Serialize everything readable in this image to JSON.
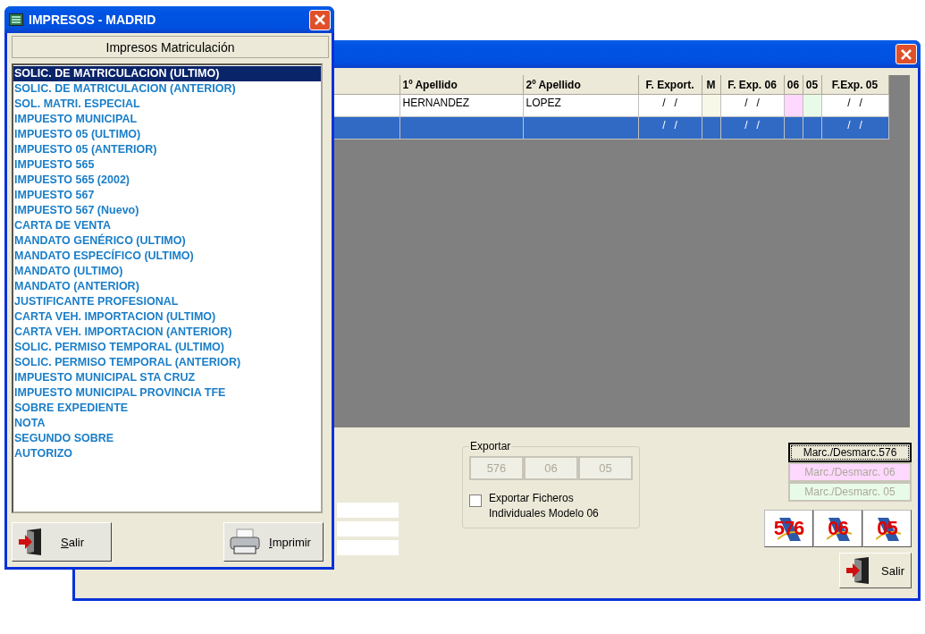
{
  "back_window": {
    "table": {
      "columns": [
        {
          "label": "1º Apellido",
          "kind": "name"
        },
        {
          "label": "2º Apellido",
          "kind": "name"
        },
        {
          "label": "F. Export.",
          "kind": "date"
        },
        {
          "label": "M",
          "kind": "flag",
          "color": "#f8f8e8"
        },
        {
          "label": "F. Exp. 06",
          "kind": "date"
        },
        {
          "label": "06",
          "kind": "flag",
          "color": "#ffd8ff"
        },
        {
          "label": "05",
          "kind": "flag",
          "color": "#e8fbe8"
        },
        {
          "label": "F.Exp. 05",
          "kind": "date"
        }
      ],
      "rows": [
        {
          "selected": false,
          "names": [
            "HERNANDEZ",
            "LOPEZ"
          ],
          "dates": [
            "/   /",
            "/   /",
            "/   /"
          ]
        },
        {
          "selected": true,
          "dates": [
            "/   /",
            "/   /",
            "/   /"
          ]
        }
      ]
    },
    "exportar": {
      "title": "Exportar",
      "buttons": [
        {
          "label": "576",
          "disabled": true
        },
        {
          "label": "06",
          "disabled": true
        },
        {
          "label": "05",
          "disabled": true
        }
      ],
      "checkbox": {
        "label": "Exportar Ficheros Individuales Modelo 06",
        "checked": false
      }
    },
    "mark_buttons": [
      {
        "label": "Marc./Desmarc.576",
        "disabled": false,
        "color": "#ece9d8",
        "focused": true
      },
      {
        "label": "Marc./Desmarc. 06",
        "disabled": true,
        "color": "#ffd8ff",
        "focused": false
      },
      {
        "label": "Marc./Desmarc. 05",
        "disabled": true,
        "color": "#e8fbe8",
        "focused": false
      }
    ],
    "form_buttons": [
      {
        "label": "576"
      },
      {
        "label": "06"
      },
      {
        "label": "05"
      }
    ],
    "exit_button": {
      "label": "Salir"
    }
  },
  "front_window": {
    "title": "IMPRESOS - MADRID",
    "header": "Impresos Matriculación",
    "items": [
      {
        "label": "SOLIC. DE MATRICULACION (ULTIMO)",
        "selected": true
      },
      {
        "label": "SOLIC. DE MATRICULACION (ANTERIOR)",
        "selected": false
      },
      {
        "label": "SOL. MATRI. ESPECIAL",
        "selected": false
      },
      {
        "label": "IMPUESTO MUNICIPAL",
        "selected": false
      },
      {
        "label": "IMPUESTO 05 (ULTIMO)",
        "selected": false
      },
      {
        "label": "IMPUESTO 05 (ANTERIOR)",
        "selected": false
      },
      {
        "label": "IMPUESTO 565",
        "selected": false
      },
      {
        "label": "IMPUESTO 565 (2002)",
        "selected": false
      },
      {
        "label": "IMPUESTO 567",
        "selected": false
      },
      {
        "label": "IMPUESTO 567 (Nuevo)",
        "selected": false
      },
      {
        "label": "CARTA DE VENTA",
        "selected": false
      },
      {
        "label": "MANDATO GENÉRICO (ULTIMO)",
        "selected": false
      },
      {
        "label": "MANDATO ESPECÍFICO (ULTIMO)",
        "selected": false
      },
      {
        "label": "MANDATO (ULTIMO)",
        "selected": false
      },
      {
        "label": "MANDATO (ANTERIOR)",
        "selected": false
      },
      {
        "label": "JUSTIFICANTE PROFESIONAL",
        "selected": false
      },
      {
        "label": "CARTA VEH. IMPORTACION (ULTIMO)",
        "selected": false
      },
      {
        "label": "CARTA VEH. IMPORTACION (ANTERIOR)",
        "selected": false
      },
      {
        "label": "SOLIC. PERMISO TEMPORAL (ULTIMO)",
        "selected": false
      },
      {
        "label": "SOLIC. PERMISO TEMPORAL (ANTERIOR)",
        "selected": false
      },
      {
        "label": "IMPUESTO MUNICIPAL STA CRUZ",
        "selected": false
      },
      {
        "label": "IMPUESTO MUNICIPAL PROVINCIA TFE",
        "selected": false
      },
      {
        "label": "SOBRE EXPEDIENTE",
        "selected": false
      },
      {
        "label": "NOTA",
        "selected": false
      },
      {
        "label": "SEGUNDO SOBRE",
        "selected": false
      },
      {
        "label": "AUTORIZO",
        "selected": false
      }
    ],
    "buttons": [
      {
        "kind": "exit",
        "mnemonic": "S",
        "rest": "alir"
      },
      {
        "kind": "print",
        "mnemonic": "I",
        "rest": "mprimir"
      }
    ]
  }
}
